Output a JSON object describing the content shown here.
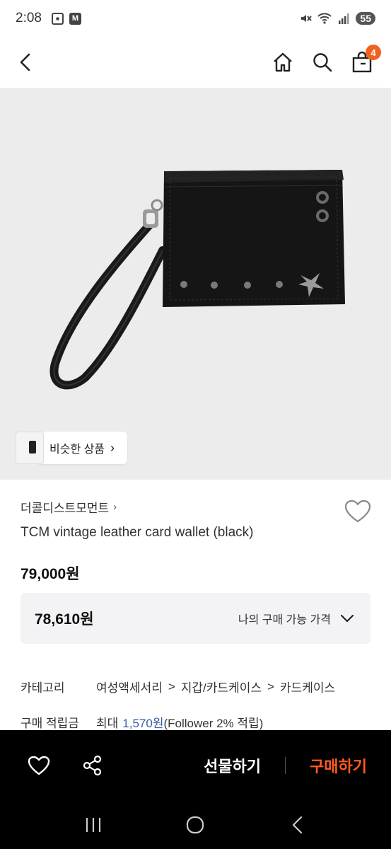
{
  "status_bar": {
    "time": "2:08",
    "battery": "55",
    "m_label": "M"
  },
  "nav": {
    "cart_count": "4"
  },
  "product_image": {
    "similar_label": "비슷한 상품",
    "similar_arrow": "›"
  },
  "product": {
    "brand": "더콜디스트모먼트",
    "brand_arrow": "›",
    "title": "TCM vintage leather card wallet (black)",
    "price": "79,000원",
    "discount_price": "78,610원",
    "discount_label": "나의 구매 가능 가격"
  },
  "details": {
    "category_key": "카테고리",
    "category_path": [
      "여성액세서리",
      "지갑/카드케이스",
      "카드케이스"
    ],
    "separator": ">",
    "points_key": "구매 적립금",
    "points_prefix": "최대",
    "points_value": "1,570원",
    "points_suffix": "(Follower 2% 적립)"
  },
  "bottom_bar": {
    "gift_label": "선물하기",
    "buy_label": "구매하기"
  },
  "colors": {
    "accent": "#ff5a1f",
    "badge": "#f0621f",
    "point_blue": "#3a5ba8",
    "image_bg": "#ececec"
  },
  "icons": [
    "back-icon",
    "home-icon",
    "search-icon",
    "cart-icon",
    "heart-icon",
    "share-icon",
    "chevron-down-icon",
    "recent-apps-icon",
    "home-circle-icon",
    "system-back-icon"
  ]
}
